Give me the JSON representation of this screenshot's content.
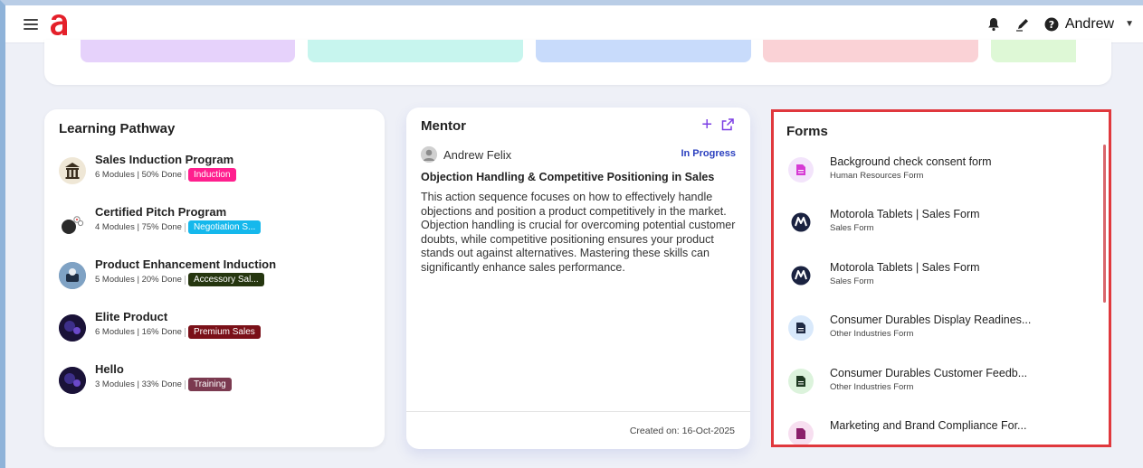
{
  "header": {
    "user_name": "Andrew",
    "icons": [
      "menu-icon",
      "bell-icon",
      "pen-icon",
      "help-icon",
      "caret-down-icon"
    ],
    "brand_color": "#e4202a"
  },
  "tiles": {
    "colors": [
      "#e6d2fb",
      "#c7f5ee",
      "#c8dbfb",
      "#fad2d6",
      "#def8d6"
    ]
  },
  "learning_pathway": {
    "title": "Learning Pathway",
    "items": [
      {
        "name": "Sales Induction Program",
        "stats": "6 Modules | 50% Done",
        "tag": "Induction",
        "tag_color": "#ff1f8e"
      },
      {
        "name": "Certified Pitch Program",
        "stats": "4 Modules | 75% Done",
        "tag": "Negotiation S...",
        "tag_color": "#15b8ec"
      },
      {
        "name": "Product Enhancement Induction",
        "stats": "5 Modules | 20% Done",
        "tag": "Accessory Sal...",
        "tag_color": "#25360f"
      },
      {
        "name": "Elite Product",
        "stats": "6 Modules | 16% Done",
        "tag": "Premium Sales",
        "tag_color": "#7a1018"
      },
      {
        "name": "Hello",
        "stats": "3 Modules | 33% Done",
        "tag": "Training",
        "tag_color": "#7b3a50"
      }
    ]
  },
  "mentor": {
    "title": "Mentor",
    "user": "Andrew Felix",
    "status": "In Progress",
    "heading": "Objection Handling & Competitive Positioning in Sales",
    "description": "This action sequence focuses on how to effectively handle objections and position a product competitively in the market. Objection handling is crucial for overcoming potential customer doubts, while competitive positioning ensures your product stands out against alternatives. Mastering these skills can significantly enhance sales performance.",
    "created": "Created on: 16-Oct-2025",
    "accent_color": "#7b3fe4"
  },
  "forms": {
    "title": "Forms",
    "items": [
      {
        "name": "Background check consent form",
        "category": "Human Resources Form",
        "icon": "document-icon"
      },
      {
        "name": "Motorola Tablets | Sales Form",
        "category": "Sales Form",
        "icon": "motorola-logo-icon"
      },
      {
        "name": "Motorola Tablets | Sales Form",
        "category": "Sales Form",
        "icon": "motorola-logo-icon"
      },
      {
        "name": "Consumer Durables Display Readines...",
        "category": "Other Industries Form",
        "icon": "document-icon"
      },
      {
        "name": "Consumer Durables Customer Feedb...",
        "category": "Other Industries Form",
        "icon": "document-icon"
      },
      {
        "name": "Marketing and Brand Compliance For...",
        "category": "",
        "icon": "document-icon"
      }
    ]
  }
}
